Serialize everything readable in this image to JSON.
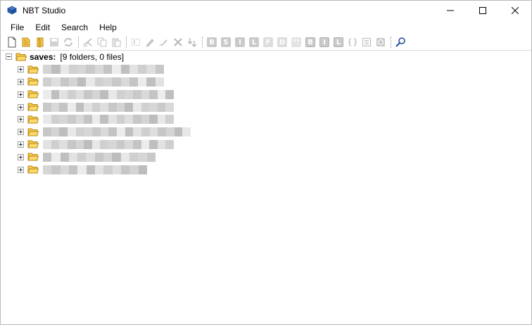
{
  "window": {
    "title": "NBT Studio",
    "controls": [
      "minimize-icon",
      "maximize-icon",
      "close-icon"
    ]
  },
  "menu": {
    "items": [
      "File",
      "Edit",
      "Search",
      "Help"
    ]
  },
  "toolbar": {
    "buttons": [
      "new-file-icon",
      "open-file-icon",
      "open-folder-icon",
      "save-icon",
      "refresh-icon",
      "cut-icon",
      "copy-icon",
      "paste-icon",
      "rename-icon",
      "edit-icon",
      "edit-snbt-icon",
      "delete-icon",
      "move-down-icon",
      "byte-tag-icon",
      "short-tag-icon",
      "int-tag-icon",
      "long-tag-icon",
      "float-tag-icon",
      "double-tag-icon",
      "string-tag-icon",
      "byte-array-icon",
      "int-array-icon",
      "long-array-icon",
      "compound-tag-icon",
      "list-tag-icon",
      "chunk-icon",
      "search-icon"
    ],
    "tag_letters": [
      "B",
      "S",
      "I",
      "L",
      "F",
      "D",
      "\"\"",
      "B",
      "I",
      "L"
    ]
  },
  "tree": {
    "root_label": "saves:",
    "root_desc": "[9 folders, 0 files]",
    "children_count_note": "9"
  },
  "colors": {
    "folder": "#f6c74a",
    "folder_stroke": "#b88a1a",
    "accent": "#1f4e9c"
  }
}
